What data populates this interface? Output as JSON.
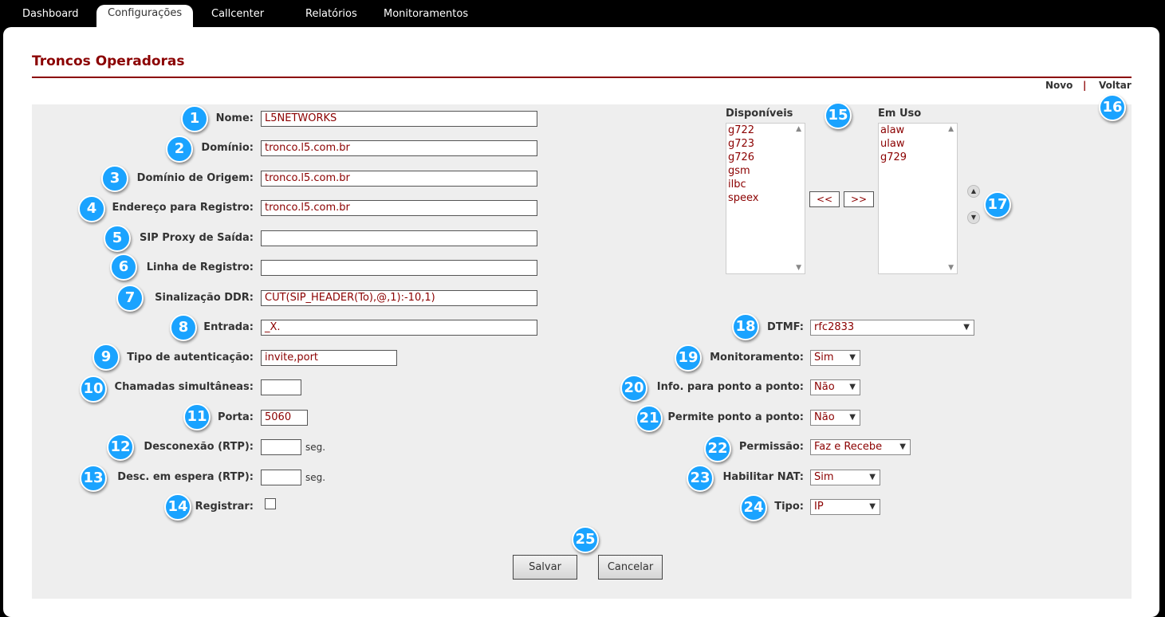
{
  "nav": {
    "tabs": [
      "Dashboard",
      "Configurações",
      "Callcenter",
      "Relatórios",
      "Monitoramentos"
    ],
    "active": "Configurações"
  },
  "page": {
    "title": "Troncos Operadoras",
    "links": {
      "novo": "Novo",
      "sep": "|",
      "voltar": "Voltar"
    }
  },
  "form": {
    "nome": {
      "label": "Nome:",
      "value": "L5NETWORKS"
    },
    "dominio": {
      "label": "Domínio:",
      "value": "tronco.l5.com.br"
    },
    "dominio_origem": {
      "label": "Domínio de Origem:",
      "value": "tronco.l5.com.br"
    },
    "endereco_registro": {
      "label": "Endereço para Registro:",
      "value": "tronco.l5.com.br"
    },
    "sip_proxy": {
      "label": "SIP Proxy de Saída:",
      "value": ""
    },
    "linha_registro": {
      "label": "Linha de Registro:",
      "value": ""
    },
    "sinalizacao_ddr": {
      "label": "Sinalização DDR:",
      "value": "CUT(SIP_HEADER(To),@,1):-10,1)"
    },
    "entrada": {
      "label": "Entrada:",
      "value": "_X."
    },
    "tipo_autenticacao": {
      "label": "Tipo de autenticação:",
      "value": "invite,port"
    },
    "chamadas_simultaneas": {
      "label": "Chamadas simultâneas:",
      "value": ""
    },
    "porta": {
      "label": "Porta:",
      "value": "5060"
    },
    "desconexao_rtp": {
      "label": "Desconexão (RTP):",
      "value": "",
      "unit": "seg."
    },
    "desc_espera_rtp": {
      "label": "Desc. em espera (RTP):",
      "value": "",
      "unit": "seg."
    },
    "registrar": {
      "label": "Registrar:",
      "checked": false
    },
    "dtmf": {
      "label": "DTMF:",
      "value": "rfc2833"
    },
    "monitoramento": {
      "label": "Monitoramento:",
      "value": "Sim"
    },
    "info_ponto": {
      "label": "Info. para ponto a ponto:",
      "value": "Não"
    },
    "permite_ponto": {
      "label": "Permite ponto a ponto:",
      "value": "Não"
    },
    "permissao": {
      "label": "Permissão:",
      "value": "Faz e Recebe"
    },
    "habilitar_nat": {
      "label": "Habilitar NAT:",
      "value": "Sim"
    },
    "tipo": {
      "label": "Tipo:",
      "value": "IP"
    }
  },
  "codecs": {
    "disponiveis_label": "Disponíveis",
    "em_uso_label": "Em Uso",
    "disponiveis": [
      "g722",
      "g723",
      "g726",
      "gsm",
      "ilbc",
      "speex"
    ],
    "em_uso": [
      "alaw",
      "ulaw",
      "g729"
    ],
    "move_left": "<<",
    "move_right": ">>"
  },
  "buttons": {
    "salvar": "Salvar",
    "cancelar": "Cancelar"
  },
  "badges": [
    "1",
    "2",
    "3",
    "4",
    "5",
    "6",
    "7",
    "8",
    "9",
    "10",
    "11",
    "12",
    "13",
    "14",
    "15",
    "16",
    "17",
    "18",
    "19",
    "20",
    "21",
    "22",
    "23",
    "24",
    "25"
  ],
  "colors": {
    "accent": "#8b0000",
    "badge": "#1aa3ff",
    "form_bg": "#eeeeee",
    "nav_bg": "#000000"
  }
}
